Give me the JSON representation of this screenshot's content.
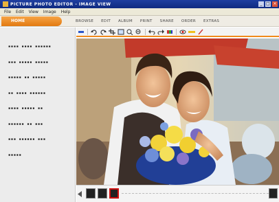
{
  "window": {
    "title": "PICTURE PHOTO EDITOR - IMAGE VIEW",
    "min_glyph": "_",
    "max_glyph": "□",
    "close_glyph": "×"
  },
  "menu": {
    "items": [
      "File",
      "Edit",
      "View",
      "Image",
      "Help"
    ]
  },
  "nav": {
    "home_label": "HOME",
    "tabs": [
      "BROWSE",
      "EDIT",
      "ALBUM",
      "PRINT",
      "SHARE",
      "ORDER",
      "EXTRAS"
    ]
  },
  "info_panel": {
    "lines": [
      "▪▪▪▪ ▪▪▪▪ ▪▪▪▪▪▪",
      "▪▪▪ ▪▪▪▪▪ ▪▪▪▪▪",
      "▪▪▪▪▪ ▪▪ ▪▪▪▪▪",
      "▪▪ ▪▪▪▪ ▪▪▪▪▪▪",
      "▪▪▪▪ ▪▪▪▪▪ ▪▪",
      "▪▪▪▪▪▪ ▪▪ ▪▪▪",
      "▪▪▪ ▪▪▪▪▪▪ ▪▪▪",
      "▪▪▪▪▪"
    ]
  },
  "toolbar": {
    "tools": [
      "select-tool-icon",
      "rotate-left-icon",
      "rotate-right-icon",
      "crop-icon",
      "fit-icon",
      "zoom-in-icon",
      "zoom-out-icon",
      "undo-icon",
      "redo-icon",
      "color-icon",
      "red-eye-icon",
      "enhance-icon",
      "tag-icon"
    ]
  },
  "photo": {
    "subject": "couple with flower bouquet"
  },
  "filmstrip": {
    "thumb_count": 3,
    "selected_index": 2
  },
  "colors": {
    "accent": "#f08a1c",
    "title_bar": "#1f3fa0",
    "selection": "#d01010"
  }
}
